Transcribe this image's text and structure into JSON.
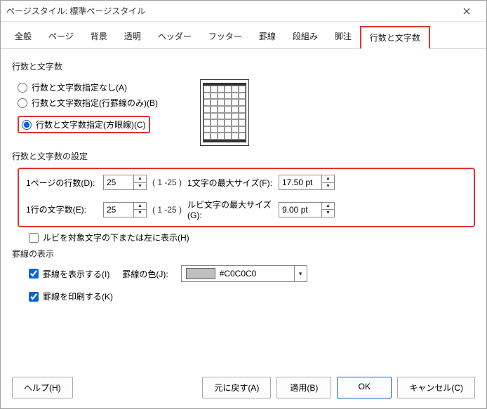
{
  "title": "ページスタイル: 標準ページスタイル",
  "tabs": [
    "全般",
    "ページ",
    "背景",
    "透明",
    "ヘッダー",
    "フッター",
    "罫線",
    "段組み",
    "脚注",
    "行数と文字数"
  ],
  "activeTab": "行数と文字数",
  "sec1": {
    "title": "行数と文字数",
    "opt1": "行数と文字数指定なし(A)",
    "opt2": "行数と文字数指定(行罫線のみ)(B)",
    "opt3": "行数と文字数指定(方眼線)(C)"
  },
  "sec2": {
    "title": "行数と文字数の設定",
    "linesLabel": "1ページの行数(D):",
    "linesValue": "25",
    "linesRange": "( 1 -25 )",
    "maxCharLabel": "1文字の最大サイズ(F):",
    "maxCharValue": "17.50 pt",
    "charsLabel": "1行の文字数(E):",
    "charsValue": "25",
    "charsRange": "( 1 -25 )",
    "rubyMaxLabel": "ルビ文字の最大サイズ(G):",
    "rubyMaxValue": "9.00 pt",
    "rubyBelow": "ルビを対象文字の下または左に表示(H)"
  },
  "sec3": {
    "title": "罫線の表示",
    "show": "罫線を表示する(I)",
    "colorLabel": "罫線の色(J):",
    "colorValue": "#C0C0C0",
    "print": "罫線を印刷する(K)"
  },
  "footer": {
    "help": "ヘルプ(H)",
    "reset": "元に戻す(A)",
    "apply": "適用(B)",
    "ok": "OK",
    "cancel": "キャンセル(C)"
  }
}
